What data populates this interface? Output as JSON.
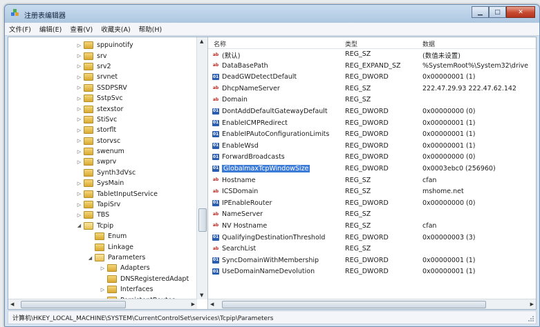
{
  "window": {
    "title": "注册表编辑器"
  },
  "menu": [
    "文件(F)",
    "编辑(E)",
    "查看(V)",
    "收藏夹(A)",
    "帮助(H)"
  ],
  "tree": {
    "items": [
      {
        "label": "sppuinotify",
        "level": 0,
        "state": "collapsed"
      },
      {
        "label": "srv",
        "level": 0,
        "state": "collapsed"
      },
      {
        "label": "srv2",
        "level": 0,
        "state": "collapsed"
      },
      {
        "label": "srvnet",
        "level": 0,
        "state": "collapsed"
      },
      {
        "label": "SSDPSRV",
        "level": 0,
        "state": "collapsed"
      },
      {
        "label": "SstpSvc",
        "level": 0,
        "state": "collapsed"
      },
      {
        "label": "stexstor",
        "level": 0,
        "state": "collapsed"
      },
      {
        "label": "StiSvc",
        "level": 0,
        "state": "collapsed"
      },
      {
        "label": "storflt",
        "level": 0,
        "state": "collapsed"
      },
      {
        "label": "storvsc",
        "level": 0,
        "state": "collapsed"
      },
      {
        "label": "swenum",
        "level": 0,
        "state": "collapsed"
      },
      {
        "label": "swprv",
        "level": 0,
        "state": "collapsed"
      },
      {
        "label": "Synth3dVsc",
        "level": 0,
        "state": "none"
      },
      {
        "label": "SysMain",
        "level": 0,
        "state": "collapsed"
      },
      {
        "label": "TabletInputService",
        "level": 0,
        "state": "collapsed"
      },
      {
        "label": "TapiSrv",
        "level": 0,
        "state": "collapsed"
      },
      {
        "label": "TBS",
        "level": 0,
        "state": "collapsed"
      },
      {
        "label": "Tcpip",
        "level": 0,
        "state": "expanded"
      },
      {
        "label": "Enum",
        "level": 1,
        "state": "none"
      },
      {
        "label": "Linkage",
        "level": 1,
        "state": "none"
      },
      {
        "label": "Parameters",
        "level": 1,
        "state": "expanded"
      },
      {
        "label": "Adapters",
        "level": 2,
        "state": "collapsed"
      },
      {
        "label": "DNSRegisteredAdapt",
        "level": 2,
        "state": "none"
      },
      {
        "label": "Interfaces",
        "level": 2,
        "state": "collapsed"
      },
      {
        "label": "PersistentRoutes",
        "level": 2,
        "state": "none"
      }
    ]
  },
  "list": {
    "headers": {
      "name": "名称",
      "type": "类型",
      "data": "数据"
    },
    "rows": [
      {
        "name": "(默认)",
        "type": "REG_SZ",
        "data": "(数值未设置)",
        "icon": "string-value-icon"
      },
      {
        "name": "DataBasePath",
        "type": "REG_EXPAND_SZ",
        "data": "%SystemRoot%\\System32\\drive",
        "icon": "string-value-icon"
      },
      {
        "name": "DeadGWDetectDefault",
        "type": "REG_DWORD",
        "data": "0x00000001 (1)",
        "icon": "binary-value-icon"
      },
      {
        "name": "DhcpNameServer",
        "type": "REG_SZ",
        "data": "222.47.29.93 222.47.62.142",
        "icon": "string-value-icon"
      },
      {
        "name": "Domain",
        "type": "REG_SZ",
        "data": "",
        "icon": "string-value-icon"
      },
      {
        "name": "DontAddDefaultGatewayDefault",
        "type": "REG_DWORD",
        "data": "0x00000000 (0)",
        "icon": "binary-value-icon"
      },
      {
        "name": "EnableICMPRedirect",
        "type": "REG_DWORD",
        "data": "0x00000001 (1)",
        "icon": "binary-value-icon"
      },
      {
        "name": "EnableIPAutoConfigurationLimits",
        "type": "REG_DWORD",
        "data": "0x00000001 (1)",
        "icon": "binary-value-icon"
      },
      {
        "name": "EnableWsd",
        "type": "REG_DWORD",
        "data": "0x00000001 (1)",
        "icon": "binary-value-icon"
      },
      {
        "name": "ForwardBroadcasts",
        "type": "REG_DWORD",
        "data": "0x00000000 (0)",
        "icon": "binary-value-icon"
      },
      {
        "name": "GlobalmaxTcpWindowSize",
        "type": "REG_DWORD",
        "data": "0x0003ebc0 (256960)",
        "icon": "binary-value-icon",
        "selected": true
      },
      {
        "name": "Hostname",
        "type": "REG_SZ",
        "data": "cfan",
        "icon": "string-value-icon"
      },
      {
        "name": "ICSDomain",
        "type": "REG_SZ",
        "data": "mshome.net",
        "icon": "string-value-icon"
      },
      {
        "name": "IPEnableRouter",
        "type": "REG_DWORD",
        "data": "0x00000000 (0)",
        "icon": "binary-value-icon"
      },
      {
        "name": "NameServer",
        "type": "REG_SZ",
        "data": "",
        "icon": "string-value-icon"
      },
      {
        "name": "NV Hostname",
        "type": "REG_SZ",
        "data": "cfan",
        "icon": "string-value-icon"
      },
      {
        "name": "QualifyingDestinationThreshold",
        "type": "REG_DWORD",
        "data": "0x00000003 (3)",
        "icon": "binary-value-icon"
      },
      {
        "name": "SearchList",
        "type": "REG_SZ",
        "data": "",
        "icon": "string-value-icon"
      },
      {
        "name": "SyncDomainWithMembership",
        "type": "REG_DWORD",
        "data": "0x00000001 (1)",
        "icon": "binary-value-icon"
      },
      {
        "name": "UseDomainNameDevolution",
        "type": "REG_DWORD",
        "data": "0x00000001 (1)",
        "icon": "binary-value-icon"
      }
    ]
  },
  "status": {
    "path": "计算机\\HKEY_LOCAL_MACHINE\\SYSTEM\\CurrentControlSet\\services\\Tcpip\\Parameters"
  },
  "colors": {
    "selection": "#3b7bd8",
    "string_icon": "#b3261e",
    "binary_icon": "#2a5db0",
    "folder": "#e6bf55"
  }
}
